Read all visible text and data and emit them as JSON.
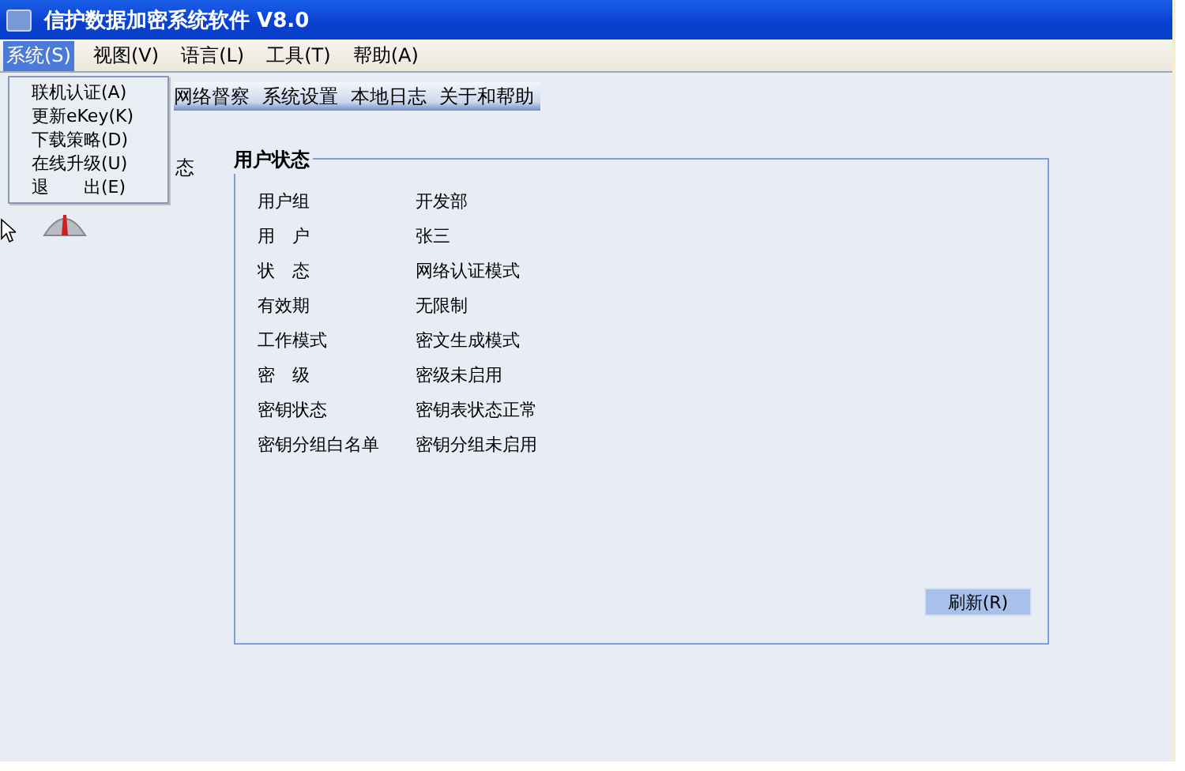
{
  "window": {
    "title": "信护数据加密系统软件 V8.0"
  },
  "menu_bar": [
    {
      "label": "系统(S)",
      "selected": true
    },
    {
      "label": "视图(V)",
      "selected": false
    },
    {
      "label": "语言(L)",
      "selected": false
    },
    {
      "label": "工具(T)",
      "selected": false
    },
    {
      "label": "帮助(A)",
      "selected": false
    }
  ],
  "dropdown": [
    {
      "label": "联机认证(A)"
    },
    {
      "label": "更新eKey(K)"
    },
    {
      "label": "下载策略(D)"
    },
    {
      "label": "在线升级(U)"
    },
    {
      "label": "退　　出(E)"
    }
  ],
  "tabs": [
    {
      "label": "网络督察"
    },
    {
      "label": "系统设置"
    },
    {
      "label": "本地日志"
    },
    {
      "label": "关于和帮助"
    }
  ],
  "side_label": "态",
  "user_status": {
    "title": "用户状态",
    "rows": [
      {
        "label": "用户组",
        "value": "开发部"
      },
      {
        "label": "用　户",
        "value": "张三"
      },
      {
        "label": "状　态",
        "value": "网络认证模式"
      },
      {
        "label": "有效期",
        "value": "无限制"
      },
      {
        "label": "工作模式",
        "value": "密文生成模式"
      },
      {
        "label": "密　级",
        "value": "密级未启用"
      },
      {
        "label": "密钥状态",
        "value": "密钥表状态正常"
      },
      {
        "label": "密钥分组白名单",
        "value": "密钥分组未启用"
      }
    ],
    "button": "刷新(R)"
  }
}
